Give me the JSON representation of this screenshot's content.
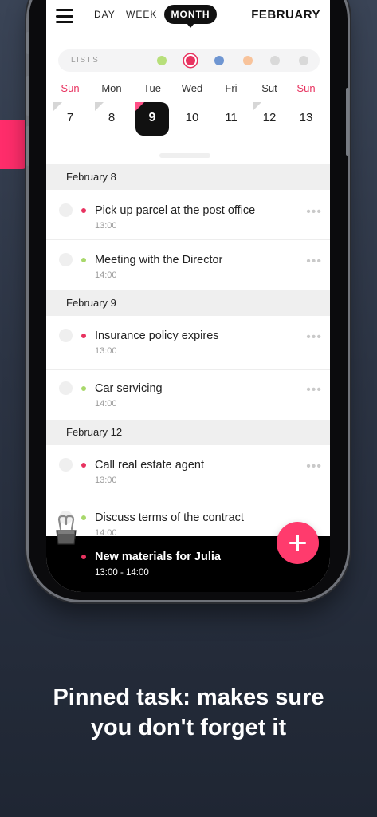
{
  "header": {
    "tabs": [
      "DAY",
      "WEEK"
    ],
    "active_tab": "MONTH",
    "month": "FEBRUARY"
  },
  "lists": {
    "label": "LISTS",
    "dots": [
      "#b7df7a",
      "#e83360",
      "#6f96d2",
      "#f8c39b",
      "#d9d9d9",
      "#d9d9d9"
    ]
  },
  "week": {
    "days": [
      "Sun",
      "Mon",
      "Tue",
      "Wed",
      "Fri",
      "Sut",
      "Sun"
    ],
    "dates": [
      "7",
      "8",
      "9",
      "10",
      "11",
      "12",
      "13"
    ],
    "selected_date": "9"
  },
  "sections": [
    {
      "title": "February 8",
      "tasks": [
        {
          "title": "Pick up parcel at the post office",
          "time": "13:00",
          "color": "#e83360"
        },
        {
          "title": "Meeting with the Director",
          "time": "14:00",
          "color": "#a8d86b"
        }
      ]
    },
    {
      "title": "February 9",
      "tasks": [
        {
          "title": "Insurance policy expires",
          "time": "13:00",
          "color": "#e83360"
        },
        {
          "title": "Car servicing",
          "time": "14:00",
          "color": "#a8d86b"
        }
      ]
    },
    {
      "title": "February 12",
      "tasks": [
        {
          "title": "Call real estate agent",
          "time": "13:00",
          "color": "#e83360"
        },
        {
          "title": "Discuss terms of the contract",
          "time": "14:00",
          "color": "#a8d86b"
        }
      ]
    }
  ],
  "pinned": {
    "title": "New materials for Julia",
    "time": "13:00 - 14:00",
    "color": "#e83360"
  },
  "icons": {
    "menu": "hamburger-icon",
    "pin": "binder-clip-icon",
    "add": "plus-icon",
    "more": "more-dots-icon"
  },
  "caption": {
    "line1": "Pinned task: makes sure",
    "line2": "you don't forget it"
  },
  "colors": {
    "accent": "#ff3b6d"
  }
}
